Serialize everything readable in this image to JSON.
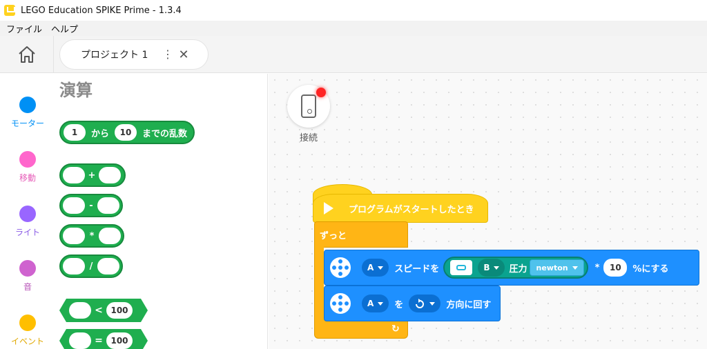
{
  "window": {
    "title": "LEGO Education SPIKE Prime - 1.3.4"
  },
  "menu": {
    "items": [
      "ファイル",
      "ヘルプ"
    ]
  },
  "tabs": {
    "project_name": "プロジェクト 1",
    "more_glyph": "⋮",
    "close_glyph": "✕"
  },
  "categories": [
    {
      "label": "モーター",
      "color": "#0090f5"
    },
    {
      "label": "移動",
      "color": "#ff66cc"
    },
    {
      "label": "ライト",
      "color": "#9966ff"
    },
    {
      "label": "音",
      "color": "#cf63cf"
    },
    {
      "label": "イベント",
      "color": "#ffbf00"
    }
  ],
  "palette": {
    "title": "演算",
    "random": {
      "from": "1",
      "from_label": "から",
      "to": "10",
      "to_label": "までの乱数"
    },
    "ops": [
      "+",
      "-",
      "*",
      "/"
    ],
    "compare": [
      {
        "op": "<",
        "value": "100"
      },
      {
        "op": "=",
        "value": "100"
      }
    ]
  },
  "canvas": {
    "connect_label": "接続",
    "hat_label": "プログラムがスタートしたとき",
    "loop_label": "ずっと",
    "loop_arrow": "↻",
    "block1": {
      "port": "A",
      "speed_label": "スピードを",
      "sensor_port": "B",
      "pressure_label": "圧力",
      "unit": "newton",
      "multiply": "*",
      "factor": "10",
      "suffix": "%にする"
    },
    "block2": {
      "port": "A",
      "wo_label": "を",
      "direction_icon": "clockwise-icon",
      "rotate_label": "方向に回す"
    }
  },
  "colors": {
    "operator_green": "#1fae4f",
    "motor_blue": "#1e90ff",
    "event_yellow": "#ffd21f",
    "control_orange": "#ffb515"
  }
}
